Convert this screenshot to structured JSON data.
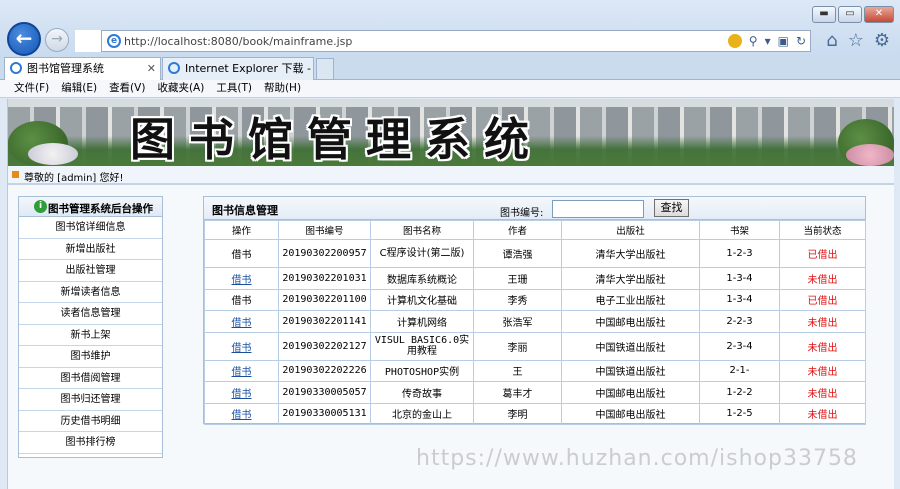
{
  "browser": {
    "url": "http://localhost:8080/book/mainframe.jsp",
    "tabs": [
      {
        "label": "图书馆管理系统",
        "active": true
      },
      {
        "label": "Internet Explorer 下载 - W...",
        "active": false
      }
    ],
    "menu": [
      "文件(F)",
      "编辑(E)",
      "查看(V)",
      "收藏夹(A)",
      "工具(T)",
      "帮助(H)"
    ],
    "window_controls": {
      "minimize": "▬",
      "maximize": "▭",
      "close": "✕"
    }
  },
  "banner": {
    "title": "图书馆管理系统"
  },
  "welcome": {
    "text": "尊敬的 [admin] 您好!"
  },
  "sidebar": {
    "title": "图书管理系统后台操作",
    "items": [
      "图书馆详细信息",
      "新增出版社",
      "出版社管理",
      "新增读者信息",
      "读者信息管理",
      "新书上架",
      "图书维护",
      "图书借阅管理",
      "图书归还管理",
      "历史借书明细",
      "图书排行榜"
    ]
  },
  "panel": {
    "title": "图书信息管理",
    "search_label": "图书编号:",
    "search_value": "",
    "search_button": "查找",
    "columns": [
      "操作",
      "图书编号",
      "图书名称",
      "作者",
      "出版社",
      "书架",
      "当前状态"
    ],
    "rows": [
      {
        "op": "借书",
        "op_link": false,
        "id": "20190302200957",
        "name": "C程序设计(第二版)",
        "author": "谭浩强",
        "publisher": "清华大学出版社",
        "shelf": "1-2-3",
        "status": "已借出"
      },
      {
        "op": "借书",
        "op_link": true,
        "id": "20190302201031",
        "name": "数据库系统概论",
        "author": "王珊",
        "publisher": "清华大学出版社",
        "shelf": "1-3-4",
        "status": "未借出"
      },
      {
        "op": "借书",
        "op_link": false,
        "id": "20190302201100",
        "name": "计算机文化基础",
        "author": "李秀",
        "publisher": "电子工业出版社",
        "shelf": "1-3-4",
        "status": "已借出"
      },
      {
        "op": "借书",
        "op_link": true,
        "id": "20190302201141",
        "name": "计算机网络",
        "author": "张浩军",
        "publisher": "中国邮电出版社",
        "shelf": "2-2-3",
        "status": "未借出"
      },
      {
        "op": "借书",
        "op_link": true,
        "id": "20190302202127",
        "name": "VISUL BASIC6.0实用教程",
        "author": "李丽",
        "publisher": "中国铁道出版社",
        "shelf": "2-3-4",
        "status": "未借出"
      },
      {
        "op": "借书",
        "op_link": true,
        "id": "20190302202226",
        "name": "PHOTOSHOP实例",
        "author": "王",
        "publisher": "中国铁道出版社",
        "shelf": "2-1-",
        "status": "未借出"
      },
      {
        "op": "借书",
        "op_link": true,
        "id": "20190330005057",
        "name": "传奇故事",
        "author": "葛丰才",
        "publisher": "中国邮电出版社",
        "shelf": "1-2-2",
        "status": "未借出"
      },
      {
        "op": "借书",
        "op_link": true,
        "id": "20190330005131",
        "name": "北京的金山上",
        "author": "李明",
        "publisher": "中国邮电出版社",
        "shelf": "1-2-5",
        "status": "未借出"
      }
    ]
  },
  "watermark": "https://www.huzhan.com/ishop33758",
  "colors": {
    "status_red": "#e01010",
    "link_blue": "#1a4fa0",
    "table_border": "#b7cde4"
  }
}
